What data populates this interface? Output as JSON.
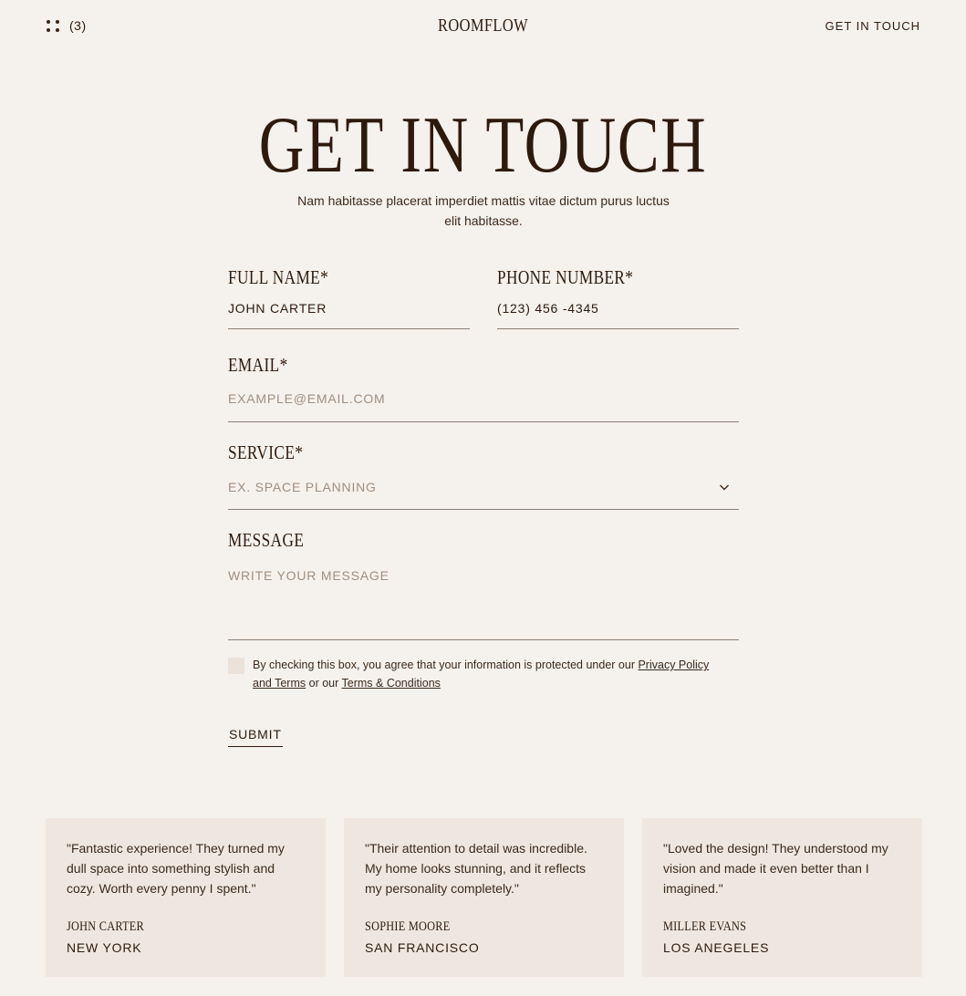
{
  "header": {
    "menu_count": "(3)",
    "logo": "ROOMFLOW",
    "cta": "GET IN TOUCH"
  },
  "hero": {
    "title": "GET IN TOUCH",
    "subtitle": "Nam habitasse placerat imperdiet mattis vitae dictum purus luctus elit habitasse."
  },
  "form": {
    "full_name": {
      "label": "FULL NAME*",
      "value": "JOHN CARTER"
    },
    "phone": {
      "label": "PHONE NUMBER*",
      "value": "(123) 456 -4345"
    },
    "email": {
      "label": "EMAIL*",
      "placeholder": "EXAMPLE@EMAIL.COM"
    },
    "service": {
      "label": "SERVICE*",
      "placeholder": "EX. SPACE PLANNING"
    },
    "message": {
      "label": "MESSAGE",
      "placeholder": "WRITE YOUR MESSAGE"
    },
    "consent": {
      "text_before": "By checking this box, you agree that your information is protected under our ",
      "link_privacy": "Privacy Policy and Terms",
      "text_middle": " or our ",
      "link_terms": "Terms & Conditions"
    },
    "submit_label": "SUBMIT"
  },
  "testimonials": [
    {
      "quote": "\"Fantastic experience! They turned my dull space into something stylish and cozy. Worth every penny I spent.\"",
      "name": "JOHN CARTER",
      "city": "NEW YORK"
    },
    {
      "quote": "\"Their attention to detail was incredible. My home looks stunning, and it reflects my personality completely.\"",
      "name": "SOPHIE MOORE",
      "city": "SAN FRANCISCO"
    },
    {
      "quote": "\"Loved the design! They understood my vision and made it even better than I imagined.\"",
      "name": "MILLER EVANS",
      "city": "LOS ANEGELES"
    }
  ],
  "colors": {
    "background": "#f5f1ec",
    "text": "#2e1a0c",
    "card": "#efe7df",
    "placeholder": "#a08f82"
  },
  "icons": {
    "menu": "four-dots-icon",
    "select": "chevron-down-icon"
  }
}
